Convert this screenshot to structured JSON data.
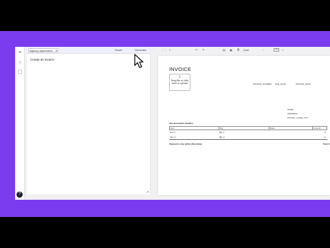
{
  "editor": {
    "agent_select": "Agency agreement",
    "reset_label": "Reset",
    "generate_label": "Generate",
    "prompt_text": "Create an invoice"
  },
  "doc_toolbar": {
    "undo": "↶",
    "redo": "↷",
    "font": "Arial",
    "zoom": "10"
  },
  "invoice": {
    "title": "INVOICE",
    "invoice_number": "INVOICE_NUMBER",
    "due_date": "DUE_DATE",
    "invoice_date": "INVOICE_DATE",
    "upload_text": "Drag file or click here to upload",
    "address": [
      "NAME",
      "ADDRESS",
      "POSTAL_CODE_CITY"
    ],
    "job_description": "Job description (details)",
    "table": {
      "headers": [
        "Item",
        "Qty",
        "Rate",
        "Amount"
      ],
      "rows": [
        {
          "item": "Item 1",
          "qty": "RE_1",
          "rate": "",
          "amount": "0"
        },
        {
          "item": "Item 2",
          "qty": "RE_2",
          "rate": "",
          "amount": "0"
        }
      ]
    },
    "payment_text": "Payment is due within {Due Date}",
    "total_label": "Total: 0"
  },
  "colors": {
    "background_band": "#7b3cf0",
    "letterbox": "#000000",
    "toolbar_tint": "#eef0fb"
  }
}
